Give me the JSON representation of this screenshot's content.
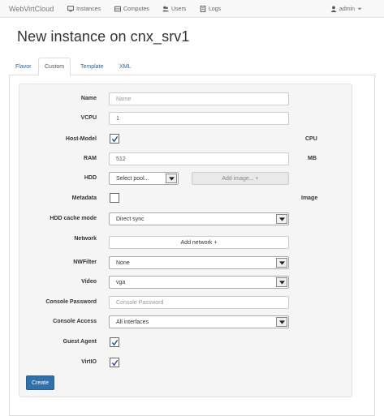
{
  "navbar": {
    "brand": "WebVirtCloud",
    "items": [
      {
        "label": "Instances",
        "icon": "monitor-icon"
      },
      {
        "label": "Computes",
        "icon": "server-icon"
      },
      {
        "label": "Users",
        "icon": "users-icon"
      },
      {
        "label": "Logs",
        "icon": "document-icon"
      }
    ],
    "user": "admin"
  },
  "page": {
    "title": "New instance on cnx_srv1"
  },
  "tabs": [
    {
      "label": "Flavor",
      "active": false
    },
    {
      "label": "Custom",
      "active": true
    },
    {
      "label": "Template",
      "active": false
    },
    {
      "label": "XML",
      "active": false
    }
  ],
  "form": {
    "name": {
      "label": "Name",
      "value": "",
      "placeholder": "Name"
    },
    "vcpu": {
      "label": "VCPU",
      "value": "1"
    },
    "host_model": {
      "label": "Host-Model",
      "checked": true,
      "suffix": "CPU"
    },
    "ram": {
      "label": "RAM",
      "value": "512",
      "suffix": "MB"
    },
    "hdd": {
      "label": "HDD",
      "select_value": "Select pool...",
      "add_image_label": "Add image... +"
    },
    "metadata": {
      "label": "Metadata",
      "checked": false,
      "suffix": "Image"
    },
    "hdd_cache": {
      "label": "HDD cache mode",
      "value": "Direct sync"
    },
    "network": {
      "label": "Network",
      "add_label": "Add network +"
    },
    "nwfilter": {
      "label": "NWFilter",
      "value": "None"
    },
    "video": {
      "label": "Video",
      "value": "vga"
    },
    "console_password": {
      "label": "Console Password",
      "value": "",
      "placeholder": "Console Password"
    },
    "console_access": {
      "label": "Console Access",
      "value": "All interfaces"
    },
    "guest_agent": {
      "label": "Guest Agent",
      "checked": true
    },
    "virtio": {
      "label": "VirtIO",
      "checked": true
    },
    "create_label": "Create"
  },
  "colors": {
    "primary": "#3071a9",
    "link": "#2a6496",
    "well": "#f5f5f5"
  }
}
